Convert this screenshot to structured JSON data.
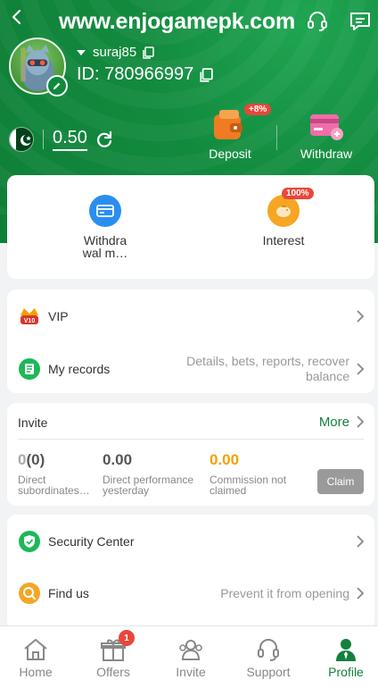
{
  "header": {
    "site_title": "www.enjogamepk.com",
    "username": "suraj85",
    "id_label": "ID: 780966997",
    "balance": "0.50",
    "deposit_label": "Deposit",
    "deposit_badge": "+8%",
    "withdraw_label": "Withdraw"
  },
  "quick_actions": {
    "withdrawal_line1": "Withdra",
    "withdrawal_line2": "wal m…",
    "interest_label": "Interest",
    "interest_badge": "100%"
  },
  "menu": {
    "vip_label": "VIP",
    "vip_badge": "V10",
    "records_label": "My records",
    "records_hint_line1": "Details, bets, reports, recover",
    "records_hint_line2": "balance"
  },
  "invite": {
    "title": "Invite",
    "more_label": "More",
    "stats": [
      {
        "value_prefix": "0",
        "value_main": "(0)",
        "label_line1": "Direct",
        "label_line2": "subordinates…"
      },
      {
        "value": "0.00",
        "label_line1": "Direct performance",
        "label_line2": "yesterday"
      },
      {
        "value": "0.00",
        "label_line1": "Commission not",
        "label_line2": "claimed"
      }
    ],
    "claim_label": "Claim"
  },
  "misc": {
    "security_label": "Security Center",
    "findus_label": "Find us",
    "findus_hint": "Prevent it from opening"
  },
  "tabbar": {
    "tabs": [
      {
        "label": "Home"
      },
      {
        "label": "Offers",
        "badge": "1"
      },
      {
        "label": "Invite"
      },
      {
        "label": "Support"
      },
      {
        "label": "Profile"
      }
    ],
    "active_tab": "Profile"
  },
  "colors": {
    "brand_green": "#128a3e",
    "accent_green": "#15803d",
    "badge_red": "#e8473a",
    "commission_orange": "#f5a000"
  }
}
